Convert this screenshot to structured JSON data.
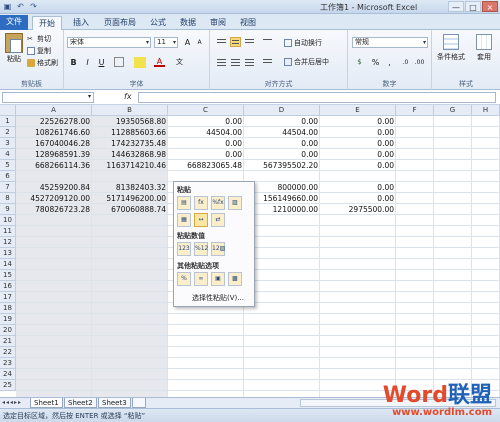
{
  "window": {
    "title": "工作簿1 - Microsoft Excel",
    "quick_access": [
      "save-icon",
      "undo-icon",
      "redo-icon"
    ],
    "controls": [
      "—",
      "□",
      "×"
    ]
  },
  "tabs": [
    {
      "label": "文件"
    },
    {
      "label": "开始"
    },
    {
      "label": "插入"
    },
    {
      "label": "页面布局"
    },
    {
      "label": "公式"
    },
    {
      "label": "数据"
    },
    {
      "label": "审阅"
    },
    {
      "label": "视图"
    }
  ],
  "ribbon": {
    "clipboard": {
      "paste": "粘贴",
      "cut": "剪切",
      "copy": "复制",
      "format_painter": "格式刷",
      "label": "剪贴板"
    },
    "font": {
      "name": "宋体",
      "size": "11",
      "bold": "B",
      "italic": "I",
      "underline": "U",
      "grow": "A",
      "shrink": "A",
      "color_letter": "A",
      "label": "字体",
      "accent_color": "#c00000"
    },
    "alignment": {
      "wrap": "自动换行",
      "merge": "合并后居中",
      "label": "对齐方式"
    },
    "number": {
      "format": "常规",
      "percent": "%",
      "comma": ",",
      "currency": "",
      "label": "数字"
    },
    "styles": {
      "conditional": "条件格式",
      "table": "套用",
      "label": "样式"
    }
  },
  "formula_bar": {
    "name_box": "",
    "fx": "fx",
    "value": ""
  },
  "columns": [
    "A",
    "B",
    "C",
    "D",
    "E",
    "F",
    "G",
    "H"
  ],
  "rows": [
    "1",
    "2",
    "3",
    "4",
    "5",
    "6",
    "7",
    "8",
    "9",
    "10",
    "11",
    "12",
    "13",
    "14",
    "15",
    "16",
    "17",
    "18",
    "19",
    "20",
    "21",
    "22",
    "23",
    "24",
    "25"
  ],
  "cells": [
    [
      "22526278.00",
      "19350568.80",
      "0.00",
      "0.00",
      "0.00"
    ],
    [
      "108261746.60",
      "112885603.66",
      "44504.00",
      "44504.00",
      "0.00"
    ],
    [
      "167040046.28",
      "174232735.48",
      "0.00",
      "0.00",
      "0.00"
    ],
    [
      "128968591.39",
      "144632868.98",
      "0.00",
      "0.00",
      "0.00"
    ],
    [
      "668266114.36",
      "1163714210.46",
      "668823065.48",
      "567395502.20",
      "0.00"
    ],
    [
      "",
      "",
      "",
      "",
      ""
    ],
    [
      "45259200.84",
      "81382403.32",
      "",
      "800000.00",
      "0.00"
    ],
    [
      "4527209120.00",
      "5171496200.00",
      "",
      "156149660.00",
      "0.00"
    ],
    [
      "780826723.28",
      "670060888.74",
      "",
      "1210000.00",
      "2975500.00"
    ]
  ],
  "context_menu": {
    "paste_header": "粘贴",
    "paste_icons": [
      "paste-icon",
      "formula-icon",
      "formula-format-icon",
      "keep-format-icon",
      "no-border-icon",
      "column-width-icon",
      "transpose-icon"
    ],
    "values_header": "粘贴数值",
    "value_icons": [
      "values-icon",
      "values-number-icon",
      "values-source-icon"
    ],
    "other_header": "其他粘贴选项",
    "other_icons": [
      "formatting-icon",
      "link-icon",
      "picture-icon",
      "linked-picture-icon"
    ],
    "special": "选择性粘贴(V)..."
  },
  "sheets": [
    "Sheet1",
    "Sheet2",
    "Sheet3"
  ],
  "status_text": "选定目标区域，然后按 ENTER 或选择 “粘贴”",
  "watermark": {
    "brand_w": "Word",
    "brand_rest": "联盟",
    "url": "www.wordlm.com"
  }
}
